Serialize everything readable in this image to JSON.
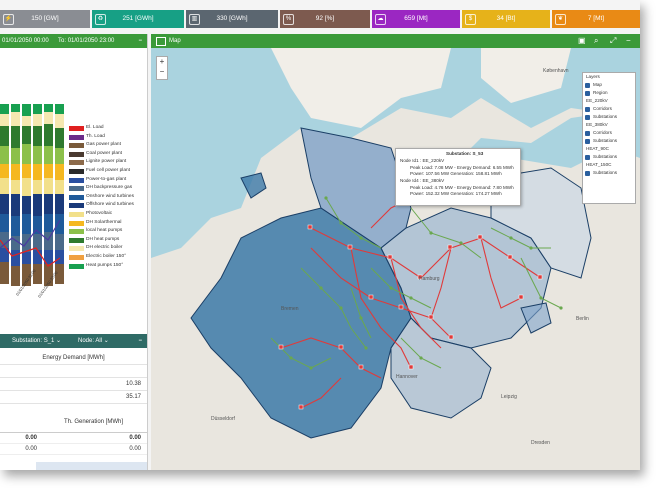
{
  "stats": [
    {
      "value": "150 [GW]",
      "color": "#8a8d93",
      "icon": "bolt-icon"
    },
    {
      "value": "251 [GWh]",
      "color": "#17a085",
      "icon": "recycle-icon"
    },
    {
      "value": "330 [GWh]",
      "color": "#5b6670",
      "icon": "factory-icon"
    },
    {
      "value": "92 [%]",
      "color": "#7d5a4f",
      "icon": "percent-icon"
    },
    {
      "value": "659 [Mt]",
      "color": "#9b27c2",
      "icon": "cloud-icon"
    },
    {
      "value": "34 [Bt]",
      "color": "#e6b21a",
      "icon": "money-icon"
    },
    {
      "value": "7 [Mt]",
      "color": "#e98a15",
      "icon": "leaf-icon"
    }
  ],
  "left_panel": {
    "from": "01/01/2050 00:00",
    "to_label": "To:",
    "to": "01/01/2050 23:00",
    "collapse": "−",
    "axis_ticks": [
      "01/01/2050 22:00",
      "01/01/2050 23:00"
    ],
    "legend": [
      {
        "label": "El. Load",
        "color": "#e02020"
      },
      {
        "label": "Th. Load",
        "color": "#6b2c8a"
      },
      {
        "label": "Gas power plant",
        "color": "#7a5a3a"
      },
      {
        "label": "Coal power plant",
        "color": "#4a3a30"
      },
      {
        "label": "Lignite power plant",
        "color": "#8c6a4a"
      },
      {
        "label": "Fuel cell power plant",
        "color": "#2a2a2a"
      },
      {
        "label": "Power-to-gas plant",
        "color": "#2a4fa0"
      },
      {
        "label": "DH backpressure gas",
        "color": "#4a6a8a"
      },
      {
        "label": "Onshore wind turbines",
        "color": "#1f5a9a"
      },
      {
        "label": "Offshore wind turbines",
        "color": "#1a3a7a"
      },
      {
        "label": "Photovoltaic",
        "color": "#f2e08a"
      },
      {
        "label": "DH Solarthermal",
        "color": "#f5b820"
      },
      {
        "label": "local heat pumps",
        "color": "#8cc04a"
      },
      {
        "label": "DH heat pumps",
        "color": "#2e7a2e"
      },
      {
        "label": "DH electric boiler",
        "color": "#f5e8b0"
      },
      {
        "label": "Electric boiler 150°",
        "color": "#f0a040"
      },
      {
        "label": "Heat pumps 150°",
        "color": "#18a050"
      }
    ]
  },
  "substation_panel": {
    "substation_label": "Substation: S_1",
    "node_label": "Node: All",
    "collapse": "−",
    "energy_header": "Energy Demand [MWh]",
    "values": [
      "10.38",
      "35.17"
    ],
    "th_header": "Th. Generation [MWh]",
    "rows": [
      {
        "a": "0.00",
        "b": "0.00",
        "bold": true
      },
      {
        "a": "0.00",
        "b": "0.00",
        "bold": false
      }
    ]
  },
  "map": {
    "title": "Map",
    "zoom_in": "+",
    "zoom_out": "−",
    "layers_title": "Layers",
    "layers": [
      {
        "label": "Map",
        "type": "cb"
      },
      {
        "label": "Region",
        "type": "cb"
      },
      {
        "label": "EE_220kV",
        "type": "grp"
      },
      {
        "label": "Corridors",
        "type": "cb"
      },
      {
        "label": "Substations",
        "type": "cb"
      },
      {
        "label": "EE_380kV",
        "type": "grp"
      },
      {
        "label": "Corridors",
        "type": "cb"
      },
      {
        "label": "Substations",
        "type": "cb"
      },
      {
        "label": "HEAT_90C",
        "type": "grp"
      },
      {
        "label": "Substations",
        "type": "cb"
      },
      {
        "label": "HEAT_150C",
        "type": "grp"
      },
      {
        "label": "Substations",
        "type": "cb"
      }
    ],
    "tooltip": {
      "title": "Substation: S_53",
      "node1": "Node Id1 : EE_220kV",
      "node1_line1": "Peak Load: 7.08 MW - Energy Demand: 6.55 MWh",
      "node1_line2": "Power: 107.56 MW  Generation: 158.81 MWh",
      "node2": "Node Id4 : EE_380kV",
      "node2_line1": "Peak Load: 4.76 MW - Energy Demand: 7.80 MWh",
      "node2_line2": "Power: 152.32 MW  Generation: 174.27 MWh"
    },
    "place_labels": [
      "København",
      "Bremen",
      "Hamburg",
      "Düsseldorf",
      "Berlin",
      "Dresden",
      "Hannover",
      "Leipzig"
    ]
  }
}
